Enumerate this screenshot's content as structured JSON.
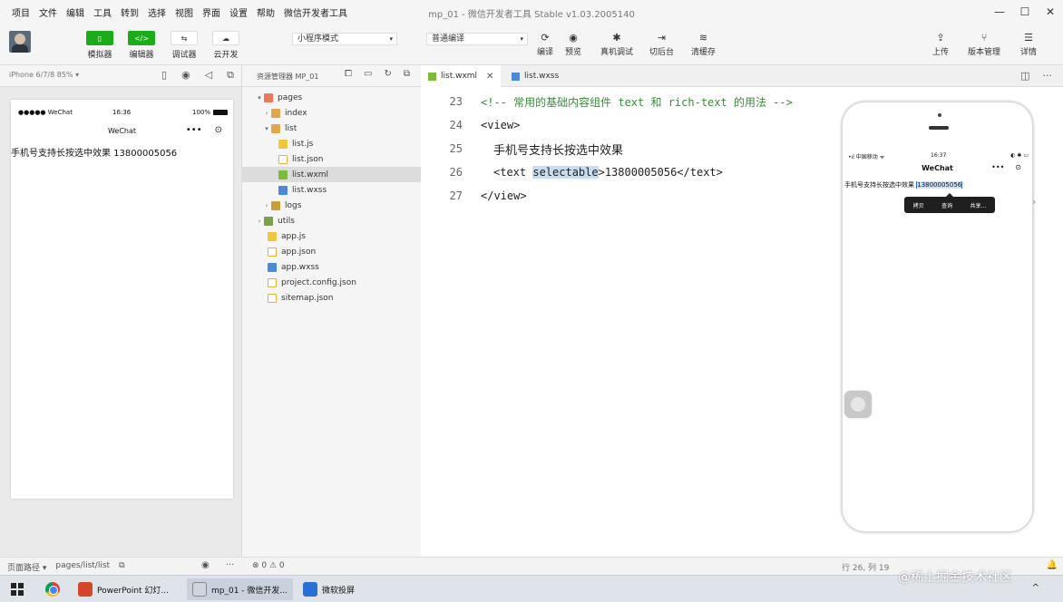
{
  "window": {
    "title": "mp_01 - 微信开发者工具 Stable v1.03.2005140",
    "menu": [
      "项目",
      "文件",
      "编辑",
      "工具",
      "转到",
      "选择",
      "视图",
      "界面",
      "设置",
      "帮助",
      "微信开发者工具"
    ],
    "controls": {
      "minimize": "—",
      "maximize": "☐",
      "close": "✕"
    }
  },
  "toolbar": {
    "simulator": "模拟器",
    "editor": "编辑器",
    "debugger": "调试器",
    "cloud": "云开发",
    "mode_select": "小程序模式",
    "compile_select": "普通编译",
    "compile": "编译",
    "preview": "预览",
    "real_debug": "真机调试",
    "background": "切后台",
    "clear_cache": "清缓存",
    "upload": "上传",
    "version": "版本管理",
    "details": "详情",
    "editor_icon_text": "</>"
  },
  "simulator": {
    "device": "iPhone 6/7/8 85% ▾",
    "status_left": "●●●●● WeChat",
    "status_time": "16:36",
    "status_battery": "100%",
    "nav_title": "WeChat",
    "nav_more": "•••",
    "nav_close": "⊙",
    "content": "手机号支持长按选中效果 13800005056"
  },
  "explorer": {
    "title": "资源管理器",
    "project": "MP_01",
    "tree": [
      {
        "name": "pages",
        "arrow": "▾",
        "color": "#e8795a"
      },
      {
        "name": "index",
        "arrow": "›",
        "color": "#e0a84a"
      },
      {
        "name": "list",
        "arrow": "▾",
        "color": "#e0a84a"
      },
      {
        "name": "list.js",
        "arrow": "",
        "color": "#f0c63a"
      },
      {
        "name": "list.json",
        "arrow": "",
        "color": "#e0b040"
      },
      {
        "name": "list.wxml",
        "arrow": "",
        "color": "#7cbb3a"
      },
      {
        "name": "list.wxss",
        "arrow": "",
        "color": "#4a8ad6"
      },
      {
        "name": "logs",
        "arrow": "›",
        "color": "#c8a03a"
      },
      {
        "name": "utils",
        "arrow": "›",
        "color": "#7aa04a"
      },
      {
        "name": "app.js",
        "arrow": "",
        "color": "#f0c63a"
      },
      {
        "name": "app.json",
        "arrow": "",
        "color": "#e0b040"
      },
      {
        "name": "app.wxss",
        "arrow": "",
        "color": "#4a8ad6"
      },
      {
        "name": "project.config.json",
        "arrow": "",
        "color": "#e0b040"
      },
      {
        "name": "sitemap.json",
        "arrow": "",
        "color": "#e0b040"
      }
    ]
  },
  "tabs": [
    {
      "label": "list.wxml",
      "close": "✕",
      "color": "#7cbb3a"
    },
    {
      "label": "list.wxss",
      "close": "",
      "color": "#4a8ad6"
    }
  ],
  "code": {
    "lines": [
      {
        "num": "23",
        "comment": "<!-- 常用的基础内容组件 text 和 rich-text 的用法 -->"
      },
      {
        "num": "24",
        "tag": "<view>"
      },
      {
        "num": "25",
        "text": "手机号支持长按选中效果"
      },
      {
        "num": "26",
        "pre": "<text ",
        "hl": "selectable",
        "post": ">13800005056</text>"
      },
      {
        "num": "27",
        "tag": "</view>"
      }
    ]
  },
  "preview": {
    "status_left": "•ıl 中国移动 ᯤ",
    "status_time": "16:37",
    "status_right": "◐ ✱ ▭",
    "title": "WeChat",
    "more": "•••",
    "close": "⊙",
    "text_prefix": "手机号支持长按选中效果 ",
    "text_selected": "13800005056",
    "menu": [
      "拷贝",
      "查询",
      "共享..."
    ],
    "side_arrow": "›"
  },
  "statusbar": {
    "path_label": "页面路径 ▾",
    "path": "pages/list/list",
    "copy": "⧉",
    "eye": "◉",
    "more": "···",
    "errors": "⊗ 0 ⚠ 0",
    "position": "行 26, 列 19",
    "bell": "🔔"
  },
  "taskbar": {
    "apps": [
      {
        "label": "PowerPoint 幻灯...",
        "color": "#d24726"
      },
      {
        "label": "mp_01 - 微信开发...",
        "color": "#cfd5dd"
      },
      {
        "label": "微软投屏",
        "color": "#2a6fd6"
      }
    ],
    "tray": "^"
  },
  "watermark": "@稀土掘金技术社区"
}
